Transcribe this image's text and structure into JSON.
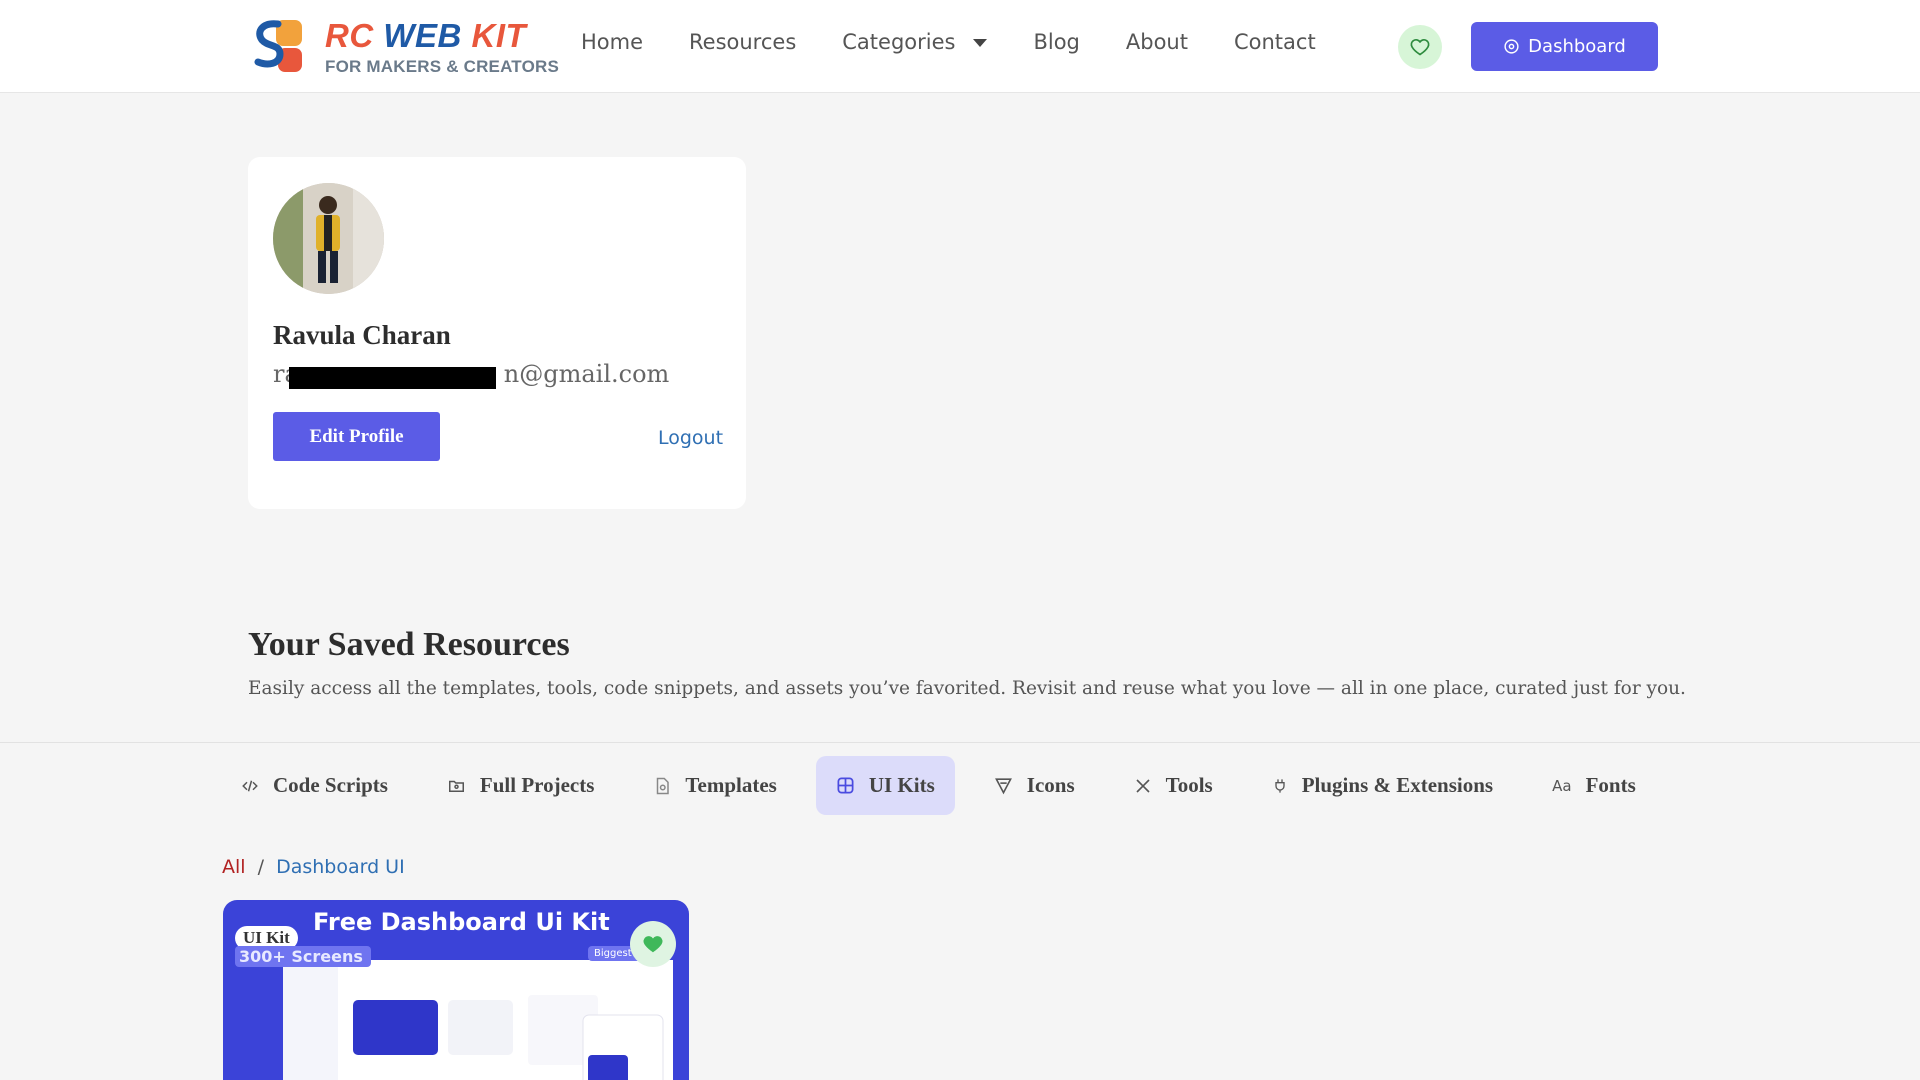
{
  "header": {
    "logo": {
      "rc": "RC",
      "web": "WEB",
      "kit": "KIT",
      "tagline": "FOR MAKERS & CREATORS"
    },
    "nav": [
      {
        "label": "Home"
      },
      {
        "label": "Resources"
      },
      {
        "label": "Categories"
      },
      {
        "label": "Blog"
      },
      {
        "label": "About"
      },
      {
        "label": "Contact"
      }
    ],
    "favorites_icon": "heart-icon",
    "dashboard_label": "Dashboard",
    "dashboard_icon": "settings-icon"
  },
  "profile": {
    "name": "Ravula Charan",
    "email_prefix": "ra",
    "email_suffix": "n@gmail.com",
    "edit_label": "Edit Profile",
    "logout_label": "Logout"
  },
  "saved": {
    "title": "Your Saved Resources",
    "description": "Easily access all the templates, tools, code snippets, and assets you’ve favorited. Revisit and reuse what you love — all in one place, curated just for you."
  },
  "tabs": [
    {
      "label": "Code Scripts",
      "icon": "code-icon",
      "active": false
    },
    {
      "label": "Full Projects",
      "icon": "folder-icon",
      "active": false
    },
    {
      "label": "Templates",
      "icon": "file-icon",
      "active": false
    },
    {
      "label": "UI Kits",
      "icon": "grid-icon",
      "active": true
    },
    {
      "label": "Icons",
      "icon": "vector-icon",
      "active": false
    },
    {
      "label": "Tools",
      "icon": "tools-icon",
      "active": false
    },
    {
      "label": "Plugins & Extensions",
      "icon": "plug-icon",
      "active": false
    },
    {
      "label": "Fonts",
      "icon": "font-icon",
      "active": false
    }
  ],
  "breadcrumb": {
    "all": "All",
    "separator": "/",
    "current": "Dashboard UI"
  },
  "resource_card": {
    "title": "Free Dashboard Ui Kit",
    "badge": "UI Kit",
    "screens": "300+ Screens",
    "tag": "Biggest U"
  },
  "colors": {
    "primary": "#5b5ce6",
    "active_tab_bg": "#dcdcfa",
    "link": "#2f6fb3",
    "breadcrumb_all": "#b22222",
    "fav_bg": "#d7f5d7"
  }
}
